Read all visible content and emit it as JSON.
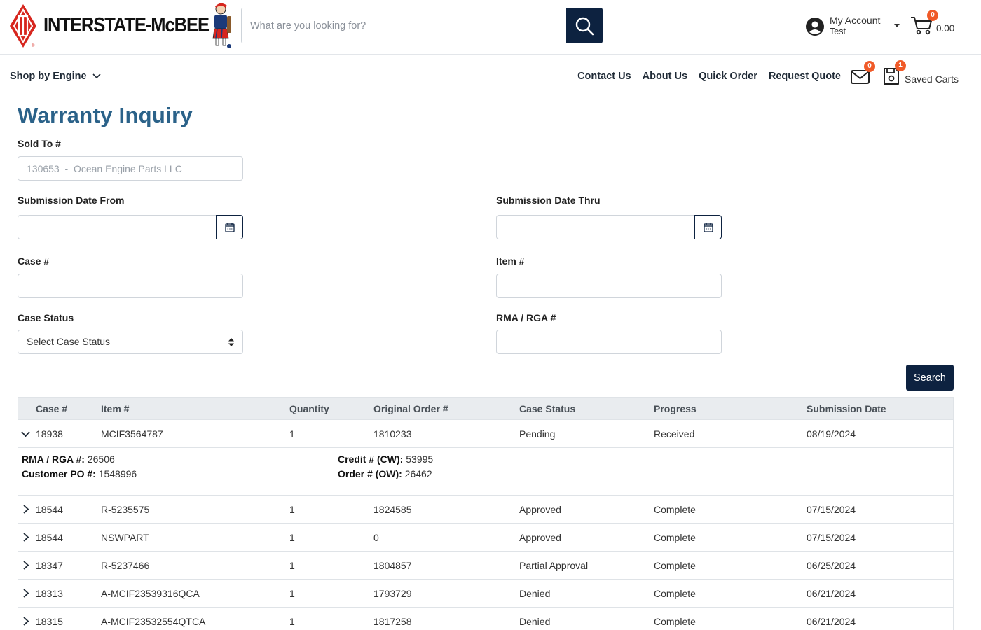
{
  "header": {
    "brand": "INTERSTATE-McBEE",
    "search_placeholder": "What are you looking for?",
    "account_title": "My Account",
    "account_user": "Test",
    "cart_badge": "0",
    "cart_total": "0.00",
    "accent_color": "#0d2240",
    "badge_color": "#f05a28"
  },
  "nav": {
    "shop_by_engine": "Shop by Engine",
    "links": [
      "Contact Us",
      "About Us",
      "Quick Order",
      "Request Quote"
    ],
    "messages_badge": "0",
    "saved_carts_badge": "1",
    "saved_carts_label": "Saved Carts"
  },
  "page": {
    "title": "Warranty Inquiry",
    "sold_to_label": "Sold To #",
    "sold_to_value": "130653  -  Ocean Engine Parts LLC",
    "date_from_label": "Submission Date From",
    "date_thru_label": "Submission Date Thru",
    "case_label": "Case #",
    "item_label": "Item #",
    "case_status_label": "Case Status",
    "case_status_value": "Select Case Status",
    "rma_label": "RMA / RGA #",
    "search_button": "Search"
  },
  "table": {
    "columns": [
      "Case #",
      "Item #",
      "Quantity",
      "Original Order #",
      "Case Status",
      "Progress",
      "Submission Date"
    ],
    "expanded": {
      "rma_label": "RMA / RGA #:",
      "rma_value": "26506",
      "po_label": "Customer PO #:",
      "po_value": "1548996",
      "credit_label": "Credit # (CW):",
      "credit_value": "53995",
      "order_label": "Order # (OW):",
      "order_value": "26462"
    },
    "rows": [
      {
        "case": "18938",
        "item": "MCIF3564787",
        "qty": "1",
        "order": "1810233",
        "status": "Pending",
        "progress": "Received",
        "date": "08/19/2024"
      },
      {
        "case": "18544",
        "item": "R-5235575",
        "qty": "1",
        "order": "1824585",
        "status": "Approved",
        "progress": "Complete",
        "date": "07/15/2024"
      },
      {
        "case": "18544",
        "item": "NSWPART",
        "qty": "1",
        "order": "0",
        "status": "Approved",
        "progress": "Complete",
        "date": "07/15/2024"
      },
      {
        "case": "18347",
        "item": "R-5237466",
        "qty": "1",
        "order": "1804857",
        "status": "Partial Approval",
        "progress": "Complete",
        "date": "06/25/2024"
      },
      {
        "case": "18313",
        "item": "A-MCIF23539316QCA",
        "qty": "1",
        "order": "1793729",
        "status": "Denied",
        "progress": "Complete",
        "date": "06/21/2024"
      },
      {
        "case": "18315",
        "item": "A-MCIF23532554QTCA",
        "qty": "1",
        "order": "1817258",
        "status": "Denied",
        "progress": "Complete",
        "date": "06/21/2024"
      }
    ]
  }
}
